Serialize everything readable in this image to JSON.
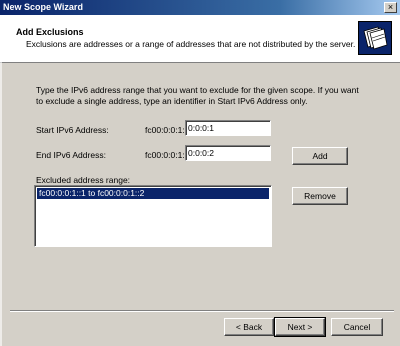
{
  "window": {
    "title": "New Scope Wizard",
    "close_glyph": "×"
  },
  "header": {
    "title": "Add Exclusions",
    "subtitle": "Exclusions are addresses or a range of addresses that are not distributed by the server."
  },
  "instructions": "Type the IPv6 address range that you want to exclude for the given scope. If you want to exclude a single address, type an identifier in Start IPv6 Address only.",
  "start": {
    "label": "Start IPv6 Address:",
    "prefix": "fc00:0:0:1:",
    "value": "0:0:0:1"
  },
  "end": {
    "label": "End IPv6 Address:",
    "prefix": "fc00:0:0:1:",
    "value": "0:0:0:2"
  },
  "excluded": {
    "label": "Excluded address range:",
    "items": [
      "fc00:0:0:1::1 to fc00:0:0:1::2"
    ]
  },
  "buttons": {
    "add": "Add",
    "remove": "Remove",
    "back": "< Back",
    "next": "Next >",
    "cancel": "Cancel"
  }
}
